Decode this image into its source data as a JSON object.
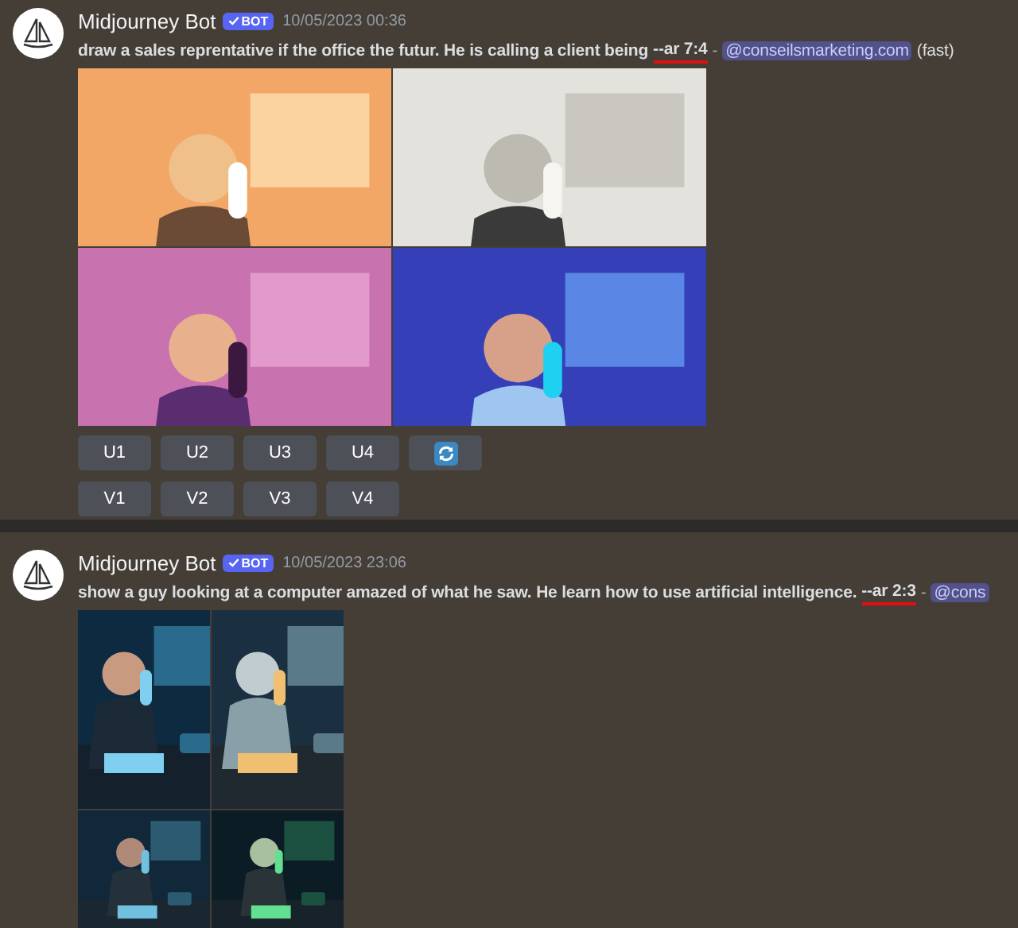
{
  "messages": [
    {
      "author": "Midjourney Bot",
      "badge": "BOT",
      "timestamp": "10/05/2023 00:36",
      "prompt": "draw a sales reprentative if the office the futur. He is calling a client being",
      "param": "--ar 7:4",
      "separator": "-",
      "mention": "@conseilsmarketing.com",
      "suffix": "(fast)",
      "kind": "landscape",
      "pictures": [
        {
          "kind": "picture"
        },
        {
          "kind": "picture"
        },
        {
          "kind": "picture"
        },
        {
          "kind": "picture"
        }
      ],
      "button_rows": [
        [
          {
            "kind": "text",
            "label": "U1"
          },
          {
            "kind": "text",
            "label": "U2"
          },
          {
            "kind": "text",
            "label": "U3"
          },
          {
            "kind": "text",
            "label": "U4"
          },
          {
            "kind": "refresh"
          }
        ],
        [
          {
            "kind": "text",
            "label": "V1"
          },
          {
            "kind": "text",
            "label": "V2"
          },
          {
            "kind": "text",
            "label": "V3"
          },
          {
            "kind": "text",
            "label": "V4"
          }
        ]
      ]
    },
    {
      "author": "Midjourney Bot",
      "badge": "BOT",
      "timestamp": "10/05/2023 23:06",
      "prompt": "show a guy looking at a computer amazed of what he saw. He learn how to use artificial intelligence.",
      "param": "--ar 2:3",
      "separator": "-",
      "mention": "@cons",
      "kind": "portrait",
      "pictures": [
        {
          "kind": "picture"
        },
        {
          "kind": "picture"
        },
        {
          "kind": "picture"
        },
        {
          "kind": "picture"
        }
      ]
    }
  ]
}
